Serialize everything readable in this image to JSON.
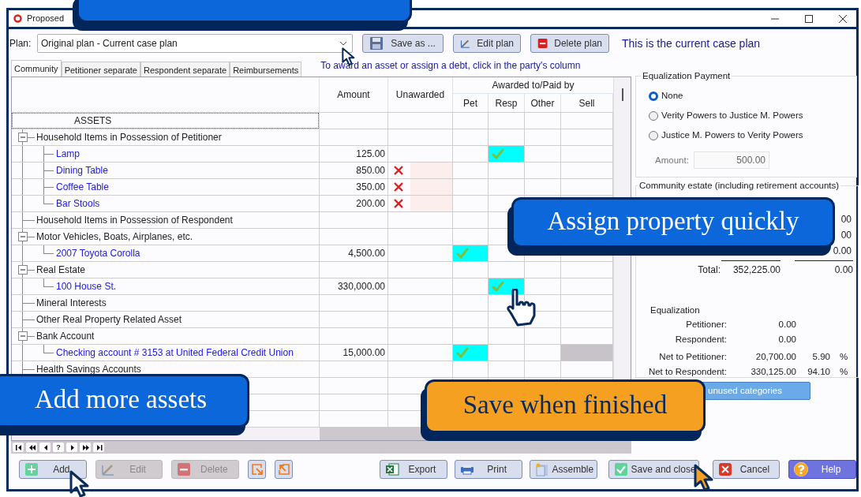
{
  "window": {
    "title": "Proposed"
  },
  "plan": {
    "label": "Plan:",
    "value": "Original plan - Current case plan",
    "note": "This is the current case plan",
    "buttons": [
      {
        "label": "Save as ...",
        "kind": "save"
      },
      {
        "label": "Edit plan",
        "kind": "edit"
      },
      {
        "label": "Delete plan",
        "kind": "delete"
      }
    ]
  },
  "tabs": [
    {
      "label": "Community",
      "selected": true
    },
    {
      "label": "Petitioner separate",
      "selected": false
    },
    {
      "label": "Respondent separate",
      "selected": false
    },
    {
      "label": "Reimbursements",
      "selected": false
    }
  ],
  "hint": "To award an asset or assign a debt, click in the party's column",
  "table": {
    "columns": {
      "amount": "Amount",
      "unawarded": "Unawarded",
      "group": "Awarded to/Paid by",
      "pet": "Pet",
      "resp": "Resp",
      "other": "Other",
      "sell": "Sell"
    },
    "section": "ASSETS",
    "categories": [
      {
        "label": "Household Items in Possession of Petitioner",
        "expanded": true,
        "children": [
          {
            "label": "Lamp",
            "amount": "125.00",
            "unawarded": false,
            "award": {
              "pet": false,
              "resp": true,
              "other": false
            },
            "sell_disabled": false
          },
          {
            "label": "Dining Table",
            "amount": "850.00",
            "unawarded": true,
            "award": {
              "pet": false,
              "resp": false,
              "other": false
            },
            "sell_disabled": false
          },
          {
            "label": "Coffee Table",
            "amount": "350.00",
            "unawarded": true,
            "award": {
              "pet": false,
              "resp": false,
              "other": false
            },
            "sell_disabled": false
          },
          {
            "label": "Bar Stools",
            "amount": "200.00",
            "unawarded": true,
            "award": {
              "pet": false,
              "resp": false,
              "other": false
            },
            "sell_disabled": false
          }
        ]
      },
      {
        "label": "Household Items in Possession of Respondent"
      },
      {
        "label": "Motor Vehicles, Boats, Airplanes, etc.",
        "expanded": true,
        "children": [
          {
            "label": "2007 Toyota Corolla",
            "amount": "4,500.00",
            "unawarded": false,
            "award": {
              "pet": true,
              "resp": false,
              "other": false
            },
            "sell_disabled": false
          }
        ]
      },
      {
        "label": "Real Estate",
        "expanded": true,
        "children": [
          {
            "label": "100 House St.",
            "amount": "330,000.00",
            "unawarded": false,
            "award": {
              "pet": false,
              "resp": true,
              "other": false
            },
            "sell_disabled": false
          }
        ]
      },
      {
        "label": "Mineral Interests"
      },
      {
        "label": "Other Real Property Related Asset"
      },
      {
        "label": "Bank Account",
        "expanded": true,
        "children": [
          {
            "label": "Checking account # 3153 at United Federal Credit Union",
            "amount": "15,000.00",
            "unawarded": false,
            "award": {
              "pet": true,
              "resp": false,
              "other": false
            },
            "sell_disabled": true
          }
        ]
      },
      {
        "label": "Health Savings Accounts"
      }
    ],
    "nav": [
      {
        "kind": "first"
      },
      {
        "kind": "prev-page"
      },
      {
        "kind": "prev"
      },
      {
        "kind": "help",
        "label": "?"
      },
      {
        "kind": "next"
      },
      {
        "kind": "next-page"
      },
      {
        "kind": "last"
      }
    ]
  },
  "equalization_payment": {
    "title": "Equalization Payment",
    "options": [
      {
        "label": "None",
        "selected": true
      },
      {
        "label": "Verity Powers to Justice M. Powers",
        "selected": false
      },
      {
        "label": "Justice M. Powers to Verity Powers",
        "selected": false
      }
    ],
    "amount_label": "Amount:",
    "amount": "500.00"
  },
  "community_estate": {
    "title": "Community estate (including retirement accounts)",
    "rows": [
      {
        "value_2": "00"
      },
      {
        "value_2": "00"
      },
      {
        "value_2": "0.00"
      }
    ],
    "total": {
      "label": "Total:",
      "value_1": "352,225.00",
      "value_2": "0.00"
    },
    "equalization": {
      "title": "Equalization",
      "rows": [
        {
          "label": "Petitioner:",
          "value": "0.00"
        },
        {
          "label": "Respondent:",
          "value": "0.00"
        },
        {
          "label": "Net to Petitioner:",
          "value": "20,700.00",
          "percent": "5.90",
          "unit": "%"
        },
        {
          "label": "Net to Respondent:",
          "value": "330,125.00",
          "percent": "94.10",
          "unit": "%"
        }
      ]
    }
  },
  "unused_button": "unused categories",
  "bottom_buttons": [
    {
      "label": "Add",
      "kind": "add",
      "disabled": false
    },
    {
      "label": "Edit",
      "kind": "edit",
      "disabled": true
    },
    {
      "label": "Delete",
      "kind": "delete",
      "disabled": true
    },
    {
      "kind": "move-in",
      "disabled": false
    },
    {
      "kind": "move-out",
      "disabled": false
    },
    {
      "label": "Export",
      "kind": "export",
      "disabled": false
    },
    {
      "label": "Print",
      "kind": "print",
      "disabled": false
    },
    {
      "label": "Assemble",
      "kind": "assemble",
      "disabled": false
    },
    {
      "label": "Save and close",
      "kind": "save-close",
      "disabled": false
    },
    {
      "label": "Cancel",
      "kind": "cancel",
      "disabled": false
    },
    {
      "label": "Help",
      "kind": "help",
      "disabled": false
    }
  ],
  "callouts": [
    {
      "kind": "blue"
    },
    {
      "kind": "blue",
      "text": "Assign property quickly"
    },
    {
      "kind": "blue",
      "text": "Add more assets"
    },
    {
      "kind": "orange",
      "text": "Save when finished"
    }
  ]
}
